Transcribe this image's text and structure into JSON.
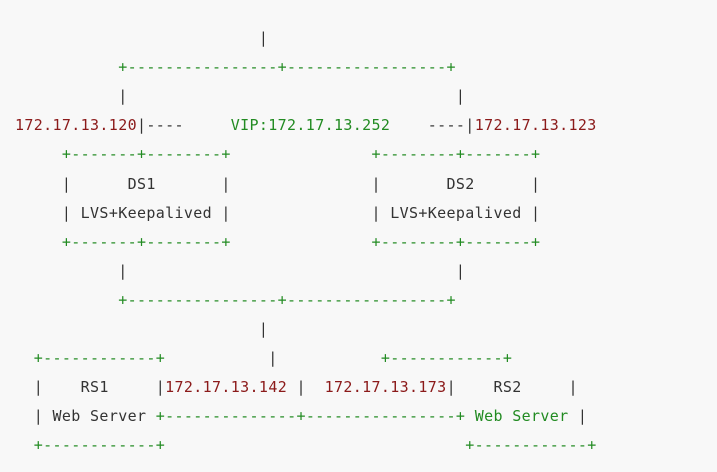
{
  "diagram": {
    "lines": [
      [
        {
          "t": "                          |",
          "c": "text"
        }
      ],
      [
        {
          "t": "           ",
          "c": "text"
        },
        {
          "t": "+----------------+-----------------+",
          "c": "green"
        }
      ],
      [
        {
          "t": "           |                                   |",
          "c": "text"
        }
      ],
      [
        {
          "t": "172.17.13.120",
          "c": "ip"
        },
        {
          "t": "|----     ",
          "c": "text"
        },
        {
          "t": "VIP:172.17.13.252",
          "c": "vip"
        },
        {
          "t": "    ----|",
          "c": "text"
        },
        {
          "t": "172.17.13.123",
          "c": "ip"
        }
      ],
      [
        {
          "t": "     ",
          "c": "text"
        },
        {
          "t": "+-------+--------+",
          "c": "green"
        },
        {
          "t": "               ",
          "c": "text"
        },
        {
          "t": "+--------+-------+",
          "c": "green"
        }
      ],
      [
        {
          "t": "     |      ",
          "c": "text"
        },
        {
          "t": "DS1",
          "c": "label"
        },
        {
          "t": "       |               |       ",
          "c": "text"
        },
        {
          "t": "DS2",
          "c": "label"
        },
        {
          "t": "      |",
          "c": "text"
        }
      ],
      [
        {
          "t": "     | ",
          "c": "text"
        },
        {
          "t": "LVS+Keepalived",
          "c": "label"
        },
        {
          "t": " |               | ",
          "c": "text"
        },
        {
          "t": "LVS+Keepalived",
          "c": "label"
        },
        {
          "t": " |",
          "c": "text"
        }
      ],
      [
        {
          "t": "     ",
          "c": "text"
        },
        {
          "t": "+-------+--------+",
          "c": "green"
        },
        {
          "t": "               ",
          "c": "text"
        },
        {
          "t": "+--------+-------+",
          "c": "green"
        }
      ],
      [
        {
          "t": "           |                                   |",
          "c": "text"
        }
      ],
      [
        {
          "t": "           ",
          "c": "text"
        },
        {
          "t": "+----------------+-----------------+",
          "c": "green"
        }
      ],
      [
        {
          "t": "                          |",
          "c": "text"
        }
      ],
      [
        {
          "t": "  ",
          "c": "text"
        },
        {
          "t": "+------------+",
          "c": "green"
        },
        {
          "t": "           |           ",
          "c": "text"
        },
        {
          "t": "+------------+",
          "c": "green"
        }
      ],
      [
        {
          "t": "  |    ",
          "c": "text"
        },
        {
          "t": "RS1",
          "c": "label"
        },
        {
          "t": "     |",
          "c": "text"
        },
        {
          "t": "172.17.13.142",
          "c": "ip"
        },
        {
          "t": " |  ",
          "c": "text"
        },
        {
          "t": "172.17.13.173",
          "c": "ip"
        },
        {
          "t": "|    ",
          "c": "text"
        },
        {
          "t": "RS2",
          "c": "label"
        },
        {
          "t": "     |",
          "c": "text"
        }
      ],
      [
        {
          "t": "  | ",
          "c": "text"
        },
        {
          "t": "Web Server",
          "c": "label"
        },
        {
          "t": " ",
          "c": "text"
        },
        {
          "t": "+--------------+----------------+",
          "c": "green"
        },
        {
          "t": " ",
          "c": "text"
        },
        {
          "t": "Web Server",
          "c": "webgreen"
        },
        {
          "t": " |",
          "c": "text"
        }
      ],
      [
        {
          "t": "  ",
          "c": "text"
        },
        {
          "t": "+------------+",
          "c": "green"
        },
        {
          "t": "                                ",
          "c": "text"
        },
        {
          "t": "+------------+",
          "c": "green"
        }
      ]
    ]
  }
}
